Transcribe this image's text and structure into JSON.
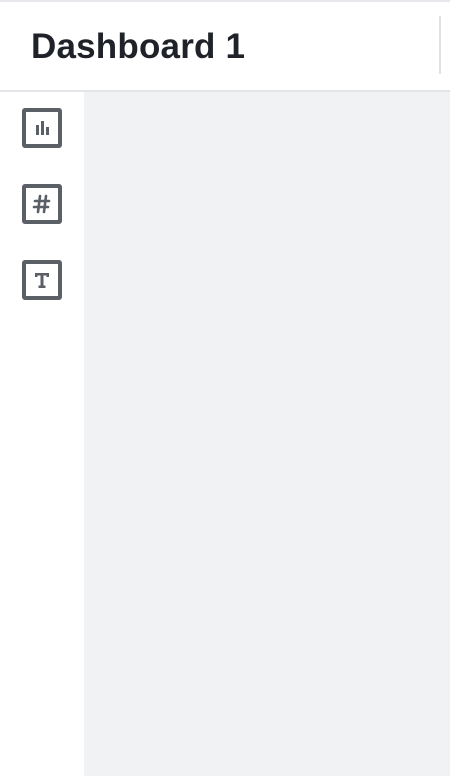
{
  "header": {
    "title": "Dashboard 1"
  },
  "toolbar": {
    "tools": [
      {
        "name": "chart",
        "icon": "bar-chart-icon"
      },
      {
        "name": "number",
        "icon": "hash-icon"
      },
      {
        "name": "text",
        "icon": "text-t-icon"
      }
    ]
  },
  "colors": {
    "title_text": "#1f2329",
    "icon_stroke": "#5b5f66",
    "canvas_background": "#f1f2f4",
    "border": "#e3e5e8"
  }
}
